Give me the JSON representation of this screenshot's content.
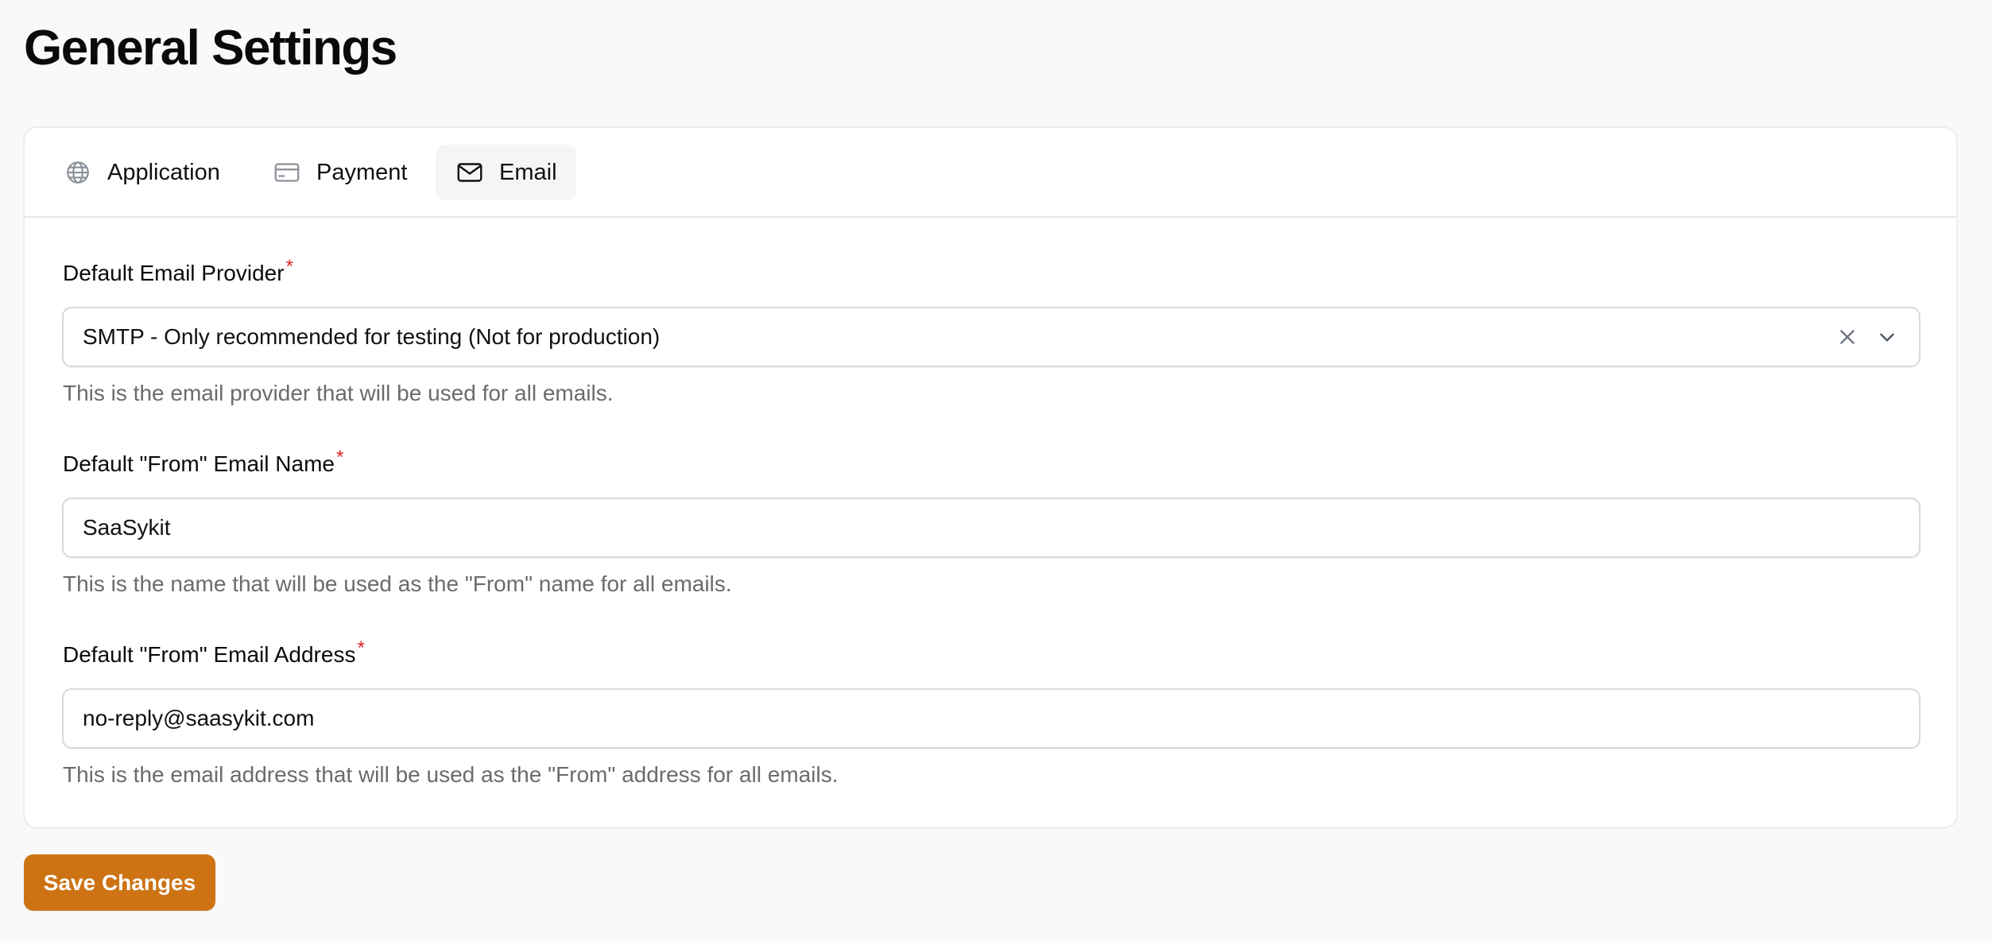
{
  "page": {
    "title": "General Settings"
  },
  "tabs": [
    {
      "label": "Application",
      "icon": "globe-icon",
      "active": false
    },
    {
      "label": "Payment",
      "icon": "credit-card-icon",
      "active": false
    },
    {
      "label": "Email",
      "icon": "envelope-icon",
      "active": true
    }
  ],
  "form": {
    "provider": {
      "label": "Default Email Provider",
      "required_marker": "*",
      "value": "SMTP - Only recommended for testing (Not for production)",
      "helper": "This is the email provider that will be used for all emails."
    },
    "from_name": {
      "label": "Default \"From\" Email Name",
      "required_marker": "*",
      "value": "SaaSykit",
      "helper": "This is the name that will be used as the \"From\" name for all emails."
    },
    "from_address": {
      "label": "Default \"From\" Email Address",
      "required_marker": "*",
      "value": "no-reply@saasykit.com",
      "helper": "This is the email address that will be used as the \"From\" address for all emails."
    }
  },
  "actions": {
    "save_label": "Save Changes"
  },
  "colors": {
    "accent": "#cd7314",
    "required": "#dc2626",
    "helper_text": "#6b6b6b",
    "background": "#f9f9f9"
  }
}
